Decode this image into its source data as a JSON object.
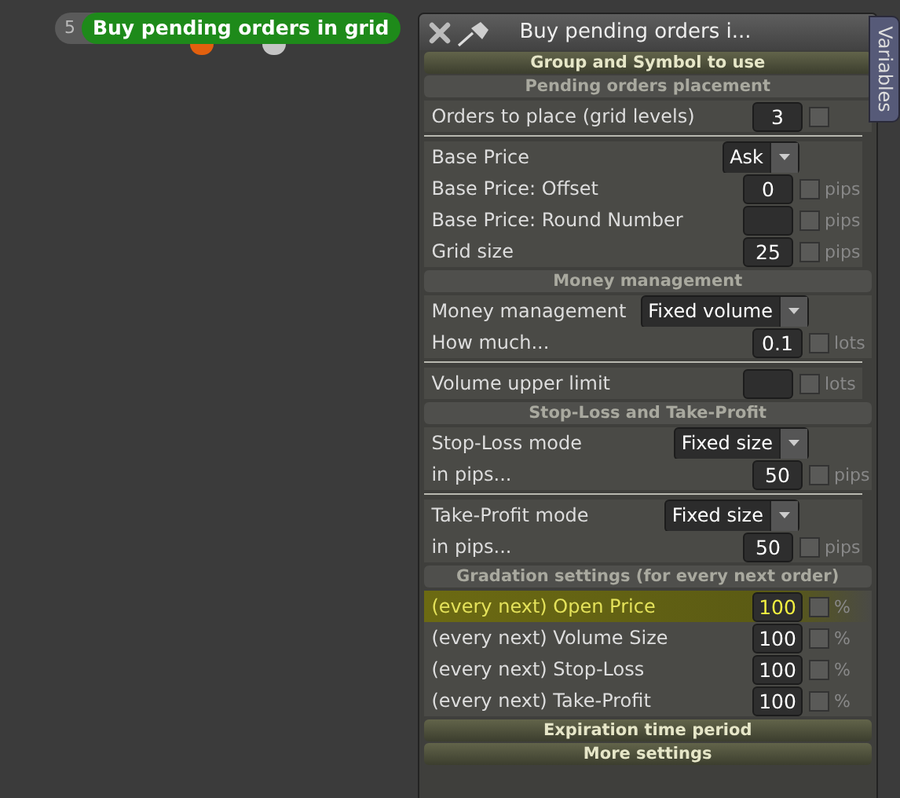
{
  "node": {
    "number": "5",
    "title": "Buy pending orders in grid",
    "ports": [
      {
        "color": "#e2600e"
      },
      {
        "color": "#c4c4c4"
      }
    ]
  },
  "panel": {
    "title": "Buy pending orders i...",
    "side_tab": "Variables",
    "sections": [
      {
        "title": "Group and Symbol to use",
        "expanded": false
      },
      {
        "title": "Pending orders placement",
        "expanded": true,
        "groups": [
          [
            {
              "kind": "number",
              "label": "Orders to place (grid levels)",
              "value": "3",
              "checked": false
            }
          ],
          [
            {
              "kind": "dropdown",
              "label": "Base Price",
              "value": "Ask"
            },
            {
              "kind": "number",
              "label": "Base Price: Offset",
              "value": "0",
              "checked": false,
              "unit": "pips"
            },
            {
              "kind": "number",
              "label": "Base Price: Round Number",
              "checked": false,
              "unit": "pips"
            },
            {
              "kind": "number",
              "label": "Grid size",
              "value": "25",
              "checked": false,
              "unit": "pips"
            }
          ]
        ]
      },
      {
        "title": "Money management",
        "expanded": true,
        "groups": [
          [
            {
              "kind": "dropdown",
              "label": "Money management",
              "value": "Fixed volume"
            },
            {
              "kind": "number",
              "label": "How much...",
              "value": "0.1",
              "checked": false,
              "unit": "lots"
            }
          ],
          [
            {
              "kind": "number",
              "label": "Volume upper limit",
              "checked": false,
              "unit": "lots"
            }
          ]
        ]
      },
      {
        "title": "Stop-Loss and Take-Profit",
        "expanded": true,
        "groups": [
          [
            {
              "kind": "dropdown",
              "label": "Stop-Loss mode",
              "value": "Fixed size"
            },
            {
              "kind": "number",
              "label": "in pips...",
              "value": "50",
              "checked": false,
              "unit": "pips"
            }
          ],
          [
            {
              "kind": "dropdown",
              "label": "Take-Profit mode",
              "value": "Fixed size"
            },
            {
              "kind": "number",
              "label": "in pips...",
              "value": "50",
              "checked": false,
              "unit": "pips"
            }
          ]
        ]
      },
      {
        "title": "Gradation settings (for every next order)",
        "expanded": true,
        "groups": [
          [
            {
              "kind": "number",
              "label": "(every next) Open Price",
              "value": "100",
              "checked": false,
              "unit": "%",
              "highlighted": true
            },
            {
              "kind": "number",
              "label": "(every next) Volume Size",
              "value": "100",
              "checked": false,
              "unit": "%",
              "highlighted": false
            },
            {
              "kind": "number",
              "label": "(every next) Stop-Loss",
              "value": "100",
              "checked": false,
              "unit": "%",
              "highlighted": false
            },
            {
              "kind": "number",
              "label": "(every next) Take-Profit",
              "value": "100",
              "checked": false,
              "unit": "%",
              "highlighted": false
            }
          ]
        ]
      },
      {
        "title": "Expiration time period",
        "expanded": false
      },
      {
        "title": "More settings",
        "expanded": false
      }
    ]
  }
}
